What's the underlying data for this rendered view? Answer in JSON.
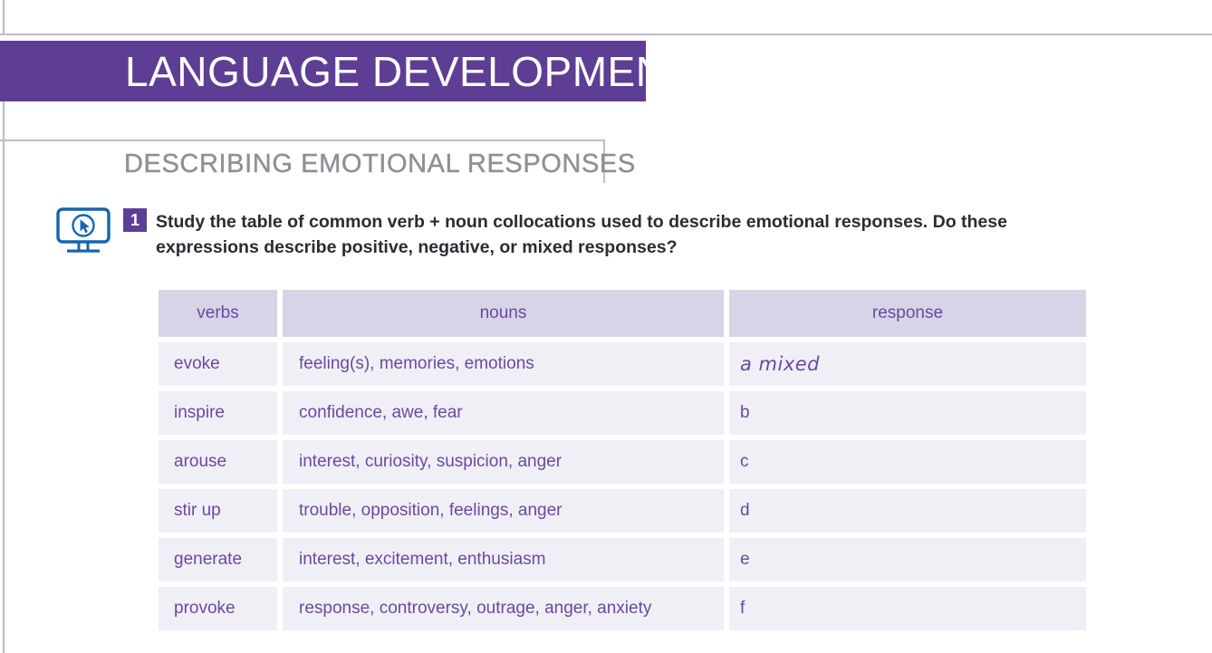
{
  "banner": {
    "title": "LANGUAGE DEVELOPMENT",
    "color": "#5e3e94"
  },
  "section": {
    "subtitle": "DESCRIBING EMOTIONAL RESPONSES"
  },
  "task": {
    "number": "1",
    "icon": "monitor-cursor-icon",
    "instruction": "Study the table of common verb + noun collocations used to describe emotional responses. Do these expressions describe positive, negative, or mixed responses?"
  },
  "table": {
    "headers": [
      "verbs",
      "nouns",
      "response"
    ],
    "header_bg": "#d8d4e7",
    "cell_bg": "#f0eff6",
    "text_color": "#6a4a9e",
    "rows": [
      {
        "verb": "evoke",
        "nouns": "feeling(s), memories, emotions",
        "response": "a mixed",
        "response_handwritten": true
      },
      {
        "verb": "inspire",
        "nouns": "confidence, awe, fear",
        "response": "b",
        "response_handwritten": false
      },
      {
        "verb": "arouse",
        "nouns": "interest, curiosity, suspicion, anger",
        "response": "c",
        "response_handwritten": false
      },
      {
        "verb": "stir up",
        "nouns": "trouble, opposition, feelings, anger",
        "response": "d",
        "response_handwritten": false
      },
      {
        "verb": "generate",
        "nouns": "interest, excitement, enthusiasm",
        "response": "e",
        "response_handwritten": false
      },
      {
        "verb": "provoke",
        "nouns": "response, controversy, outrage, anger, anxiety",
        "response": "f",
        "response_handwritten": false
      }
    ]
  }
}
